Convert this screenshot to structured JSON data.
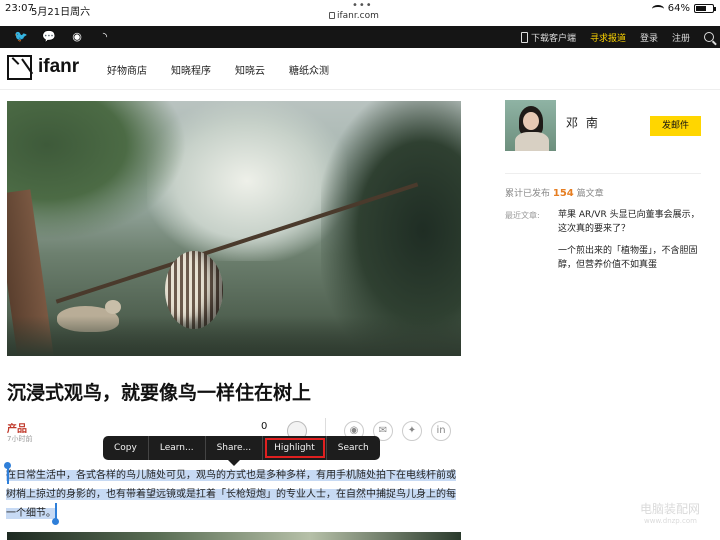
{
  "status_bar": {
    "time": "23:07",
    "date": "5月21日周六",
    "dots": "•••",
    "url": "ifanr.com",
    "battery": "64%",
    "battery_level": 0.64
  },
  "topbar": {
    "social_icons": [
      "twitter-icon",
      "wechat-icon",
      "weibo-icon",
      "rss-icon"
    ],
    "download": "下载客户端",
    "report": "寻求报道",
    "login": "登录",
    "register": "注册",
    "accent_color": "#ffd600"
  },
  "nav": {
    "logo": "ifanr",
    "items": [
      "好物商店",
      "知晓程序",
      "知晓云",
      "糖纸众测"
    ]
  },
  "article": {
    "title": "沉浸式观鸟，就要像鸟一样住在树上",
    "category": "产品",
    "time_ago": "7小时前",
    "like_count": "0",
    "paragraph_selected": "在日常生活中，各式各样的鸟儿随处可见，观鸟的方式也是多种多样，有用手机随处拍下在电线杆前或树梢上掠过的身影的，也有带着望远镜或是扛着「长枪短炮」的专业人士，在自然中捕捉鸟儿身上的每一个细节。"
  },
  "popup_menu": {
    "items": [
      "Copy",
      "Learn...",
      "Share...",
      "Highlight",
      "Search"
    ]
  },
  "sidebar": {
    "author": "邓 南",
    "write_button": "发邮件",
    "stats_prefix": "累计已发布",
    "stats_count": "154",
    "stats_suffix": "篇文章",
    "recent_label": "最近文章:",
    "recent_articles": [
      "苹果 AR/VR 头显已向董事会展示，这次真的要来了？",
      "一个煎出来的「植物蛋」，不含胆固醇，但营养价值不如真蛋"
    ]
  },
  "watermark": {
    "line1": "电脑装配网",
    "line2": "www.dnzp.com"
  }
}
